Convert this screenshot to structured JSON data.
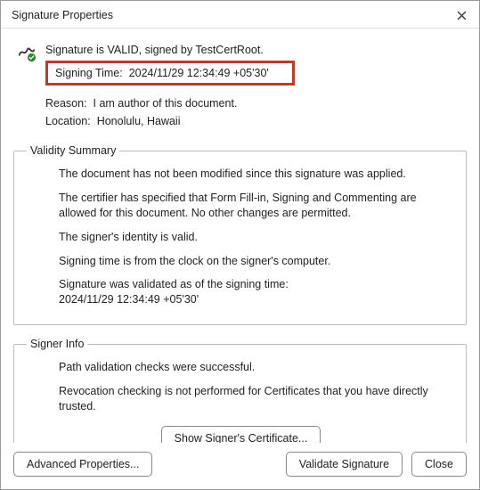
{
  "window": {
    "title": "Signature Properties"
  },
  "icons": {
    "close": "close-icon",
    "signature": "signature-valid-icon"
  },
  "signature": {
    "valid_text": "Signature is VALID, signed by TestCertRoot.",
    "signing_time_label": "Signing Time:",
    "signing_time_value": "2024/11/29 12:34:49 +05'30'",
    "reason_label": "Reason:",
    "reason_value": "I am author of this document.",
    "location_label": "Location:",
    "location_value": "Honolulu, Hawaii"
  },
  "validity_summary": {
    "legend": "Validity Summary",
    "lines": [
      "The document has not been modified since this signature was applied.",
      "The certifier has specified that Form Fill-in, Signing and Commenting are allowed for this document. No other changes are permitted.",
      "The signer's identity is valid.",
      "Signing time is from the clock on the signer's computer.",
      "Signature was validated as of the signing time:\n2024/11/29 12:34:49 +05'30'"
    ]
  },
  "signer_info": {
    "legend": "Signer Info",
    "lines": [
      "Path validation checks were successful.",
      "Revocation checking is not performed for Certificates that you have directly trusted."
    ],
    "show_cert_button": "Show Signer's Certificate..."
  },
  "footer": {
    "advanced": "Advanced Properties...",
    "validate": "Validate Signature",
    "close": "Close"
  },
  "colors": {
    "highlight_border": "#C0392B",
    "valid_check": "#2a8a2a"
  }
}
